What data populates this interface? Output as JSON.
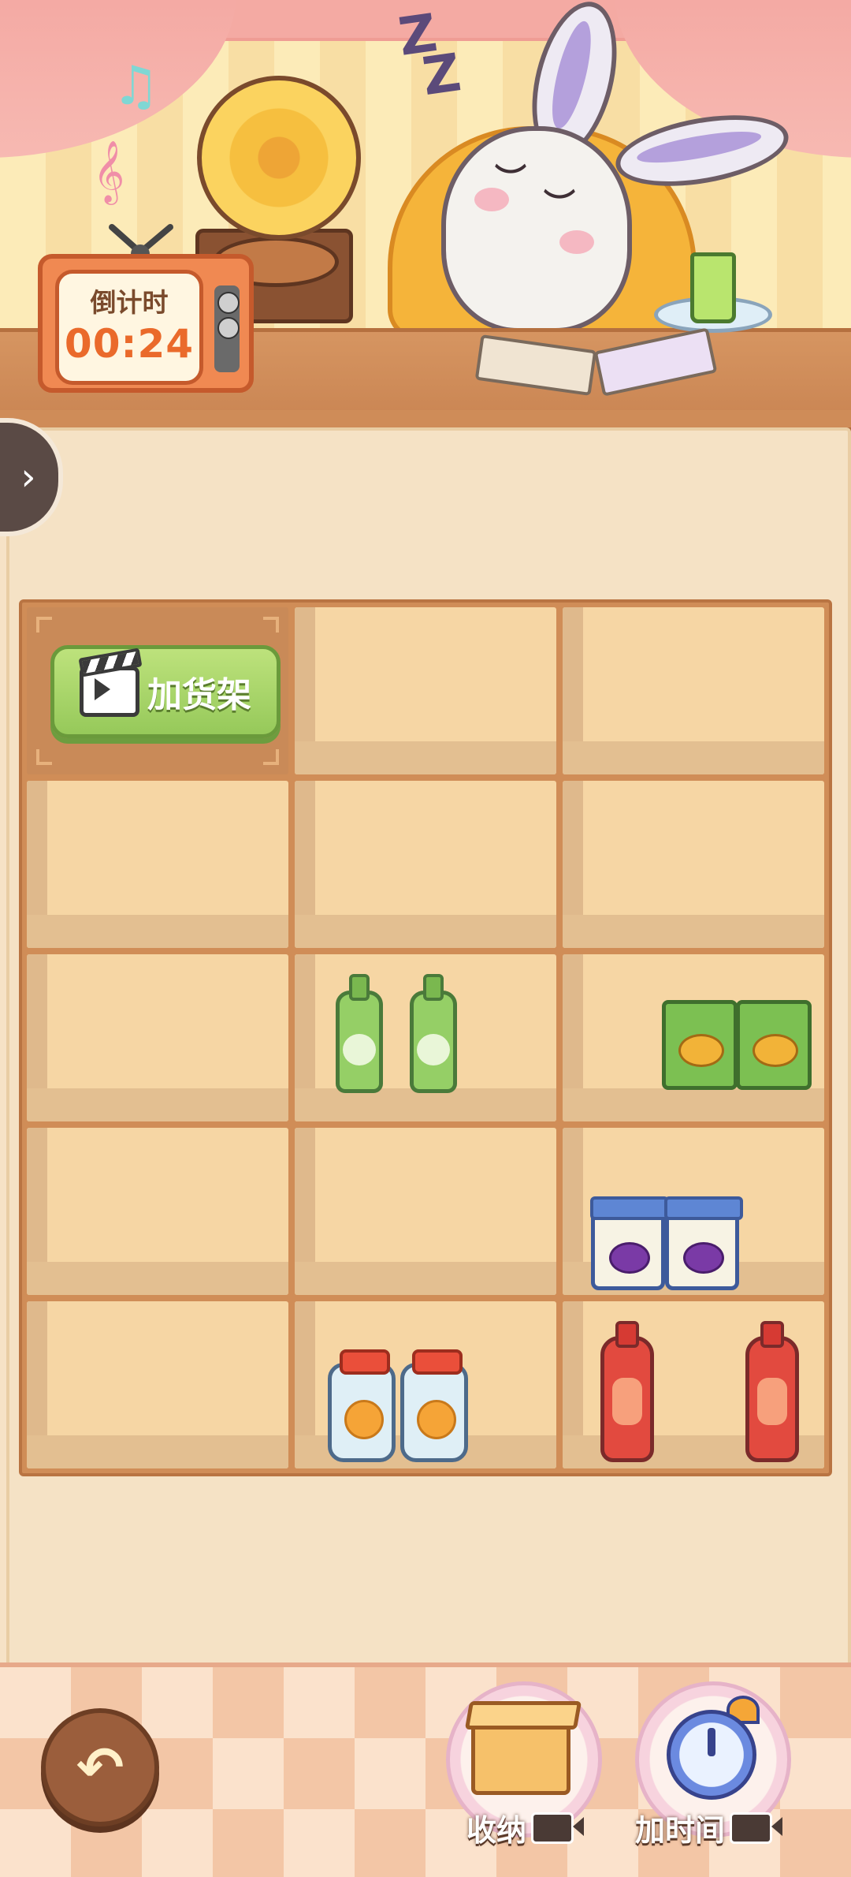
{
  "timer": {
    "label": "倒计时",
    "value": "00:24"
  },
  "scene": {
    "character": "sleeping-bunny",
    "props": [
      "gramophone",
      "tv-timer",
      "sofa",
      "lime-drink",
      "letters"
    ]
  },
  "side_panel": {
    "toggle_icon": "chevron-right-icon"
  },
  "shelf": {
    "columns": 3,
    "rows": 5,
    "add_shelf_label": "加货架",
    "slots": [
      {
        "row": 1,
        "col": 1,
        "content": "add-shelf-button"
      },
      {
        "row": 1,
        "col": 2,
        "content": "empty"
      },
      {
        "row": 1,
        "col": 3,
        "content": "empty"
      },
      {
        "row": 2,
        "col": 1,
        "content": "empty"
      },
      {
        "row": 2,
        "col": 2,
        "content": "empty"
      },
      {
        "row": 2,
        "col": 3,
        "content": "empty"
      },
      {
        "row": 3,
        "col": 1,
        "content": "empty"
      },
      {
        "row": 3,
        "col": 2,
        "content": "green-bottle",
        "count": 2
      },
      {
        "row": 3,
        "col": 3,
        "content": "chips-bag",
        "count": 2
      },
      {
        "row": 4,
        "col": 1,
        "content": "empty"
      },
      {
        "row": 4,
        "col": 2,
        "content": "empty"
      },
      {
        "row": 4,
        "col": 3,
        "content": "jam-jar",
        "count": 2
      },
      {
        "row": 5,
        "col": 1,
        "content": "empty"
      },
      {
        "row": 5,
        "col": 2,
        "content": "orange-juice-jar",
        "count": 2
      },
      {
        "row": 5,
        "col": 3,
        "content": "red-soda-bottle",
        "count": 2
      }
    ]
  },
  "bottom_bar": {
    "back_icon": "undo-arrow-icon",
    "storage_label": "收纳",
    "add_time_label": "加时间",
    "video_icon": "video-ad-icon"
  },
  "colors": {
    "wood": "#d08d57",
    "shelf_inside": "#f6d6a4",
    "accent_green": "#96c95a",
    "timer_orange": "#ea6a2b"
  }
}
